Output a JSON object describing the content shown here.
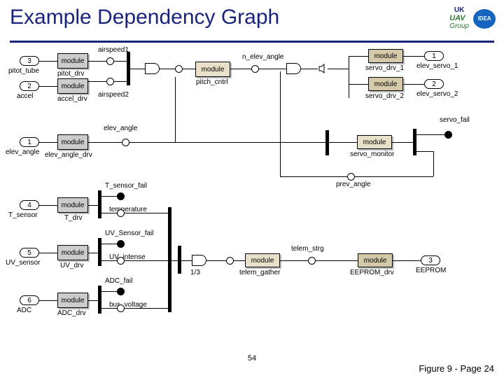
{
  "title": "Example Dependency Graph",
  "logo": {
    "uk": "UK",
    "uav": "UAV",
    "group": "Group",
    "idea": "IDEA"
  },
  "footer": {
    "page_num": "54",
    "figure": "Figure 9 - Page 24"
  },
  "labels": {
    "airspeed1": "airspeed1",
    "pitot_tube": "pitot_tube",
    "pitot_drv": "pitot_drv",
    "accel": "accel",
    "accel_drv": "accel_drv",
    "airspeed2": "airspeed2",
    "elev_angle_in": "elev_angle",
    "elev_angle_drv": "elev_angle_drv",
    "elev_angle": "elev_angle",
    "pitch_cntrl": "pitch_cntrl",
    "n_elev_angle": "n_elev_angle",
    "servo_drv_1": "servo_drv_1",
    "elev_servo_1": "elev_servo_1",
    "servo_drv_2": "servo_drv_2",
    "elev_servo_2": "elev_servo_2",
    "servo_fail": "servo_fail",
    "servo_monitor": "servo_monitor",
    "prev_angle": "prev_angle",
    "T_sensor": "T_sensor",
    "T_drv": "T_drv",
    "T_sensor_fail": "T_sensor_fail",
    "temperature": "temperature",
    "UV_sensor": "UV_sensor",
    "UV_drv": "UV_drv",
    "UV_Sensor_fail": "UV_Sensor_fail",
    "UV_intense": "UV_intense",
    "ADC": "ADC",
    "ADC_drv": "ADC_drv",
    "ADC_fail": "ADC_fail",
    "bus_voltage": "bus_voltage",
    "one_third": "1/3",
    "telem_strg": "telem_strg",
    "telem_gather": "telem_gather",
    "EEPROM_drv": "EEPROM_drv",
    "EEPROM": "EEPROM",
    "module": "module"
  },
  "ports": {
    "in1": "1",
    "in2": "2",
    "in3": "3",
    "in4": "4",
    "in5": "5",
    "in6": "6",
    "out1": "1",
    "out2": "2",
    "out3": "3"
  }
}
